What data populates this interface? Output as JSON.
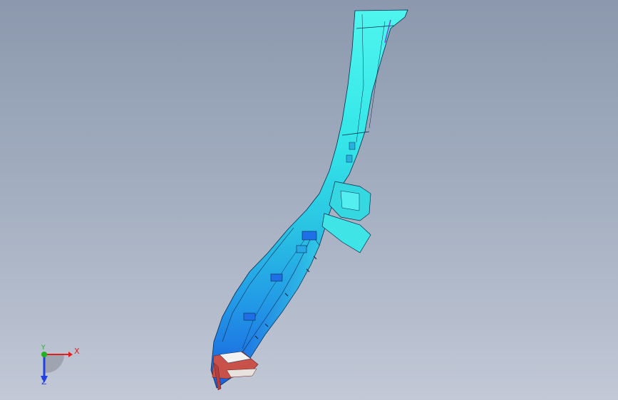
{
  "viewport": {
    "background_top": "#8b98ad",
    "background_bottom": "#c2c8d6"
  },
  "model": {
    "colors": {
      "surface_light": "#3ff2ea",
      "surface_mid": "#22c9de",
      "surface_dark": "#1f70e6",
      "edge": "#0a2a4a",
      "inner_red": "#c8524a",
      "inner_white": "#f2f2f2",
      "accent_purple": "#7a3fc8"
    }
  },
  "triad": {
    "x_label": "X",
    "y_label": "Y",
    "z_label": "Z",
    "x_color": "#e02020",
    "y_color": "#20b020",
    "z_color": "#2040e0"
  }
}
